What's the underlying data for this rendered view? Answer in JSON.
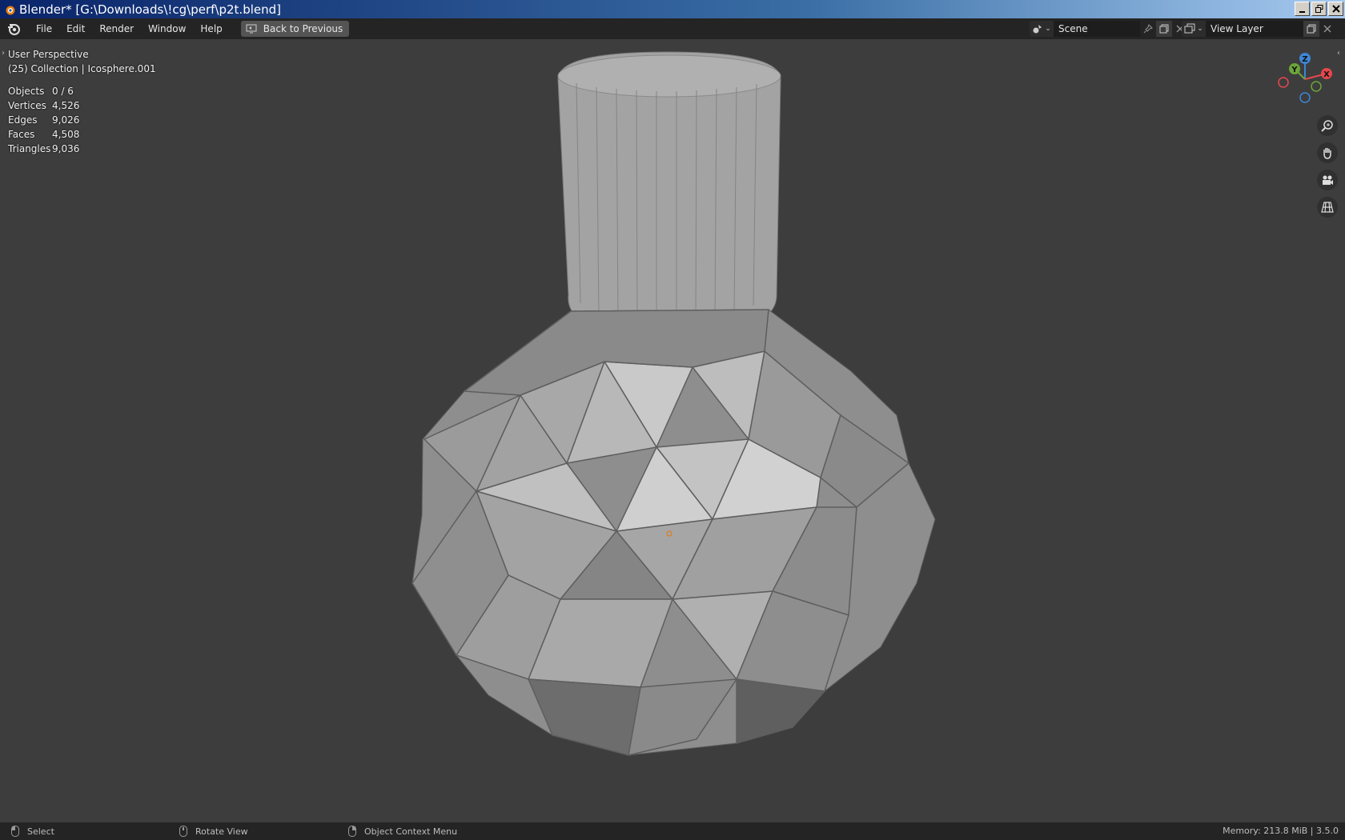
{
  "window": {
    "title": "Blender* [G:\\Downloads\\!cg\\perf\\p2t.blend]"
  },
  "menu": {
    "items": [
      "File",
      "Edit",
      "Render",
      "Window",
      "Help"
    ],
    "back_button": "Back to Previous"
  },
  "scene": {
    "name": "Scene"
  },
  "view_layer": {
    "name": "View Layer"
  },
  "viewport": {
    "perspective": "User Perspective",
    "collection": "(25) Collection | Icosphere.001",
    "stats": [
      {
        "label": "Objects",
        "value": "0 / 6"
      },
      {
        "label": "Vertices",
        "value": "4,526"
      },
      {
        "label": "Edges",
        "value": "9,026"
      },
      {
        "label": "Faces",
        "value": "4,508"
      },
      {
        "label": "Triangles",
        "value": "9,036"
      }
    ],
    "gizmo_labels": {
      "x": "X",
      "y": "Y",
      "z": "Z"
    }
  },
  "statusbar": {
    "select": "Select",
    "rotate": "Rotate View",
    "context": "Object Context Menu",
    "memory": "Memory: 213.8 MiB | 3.5.0"
  },
  "colors": {
    "axis_x": "#e5484d",
    "axis_y": "#6ca53a",
    "axis_z": "#3d86d6"
  }
}
